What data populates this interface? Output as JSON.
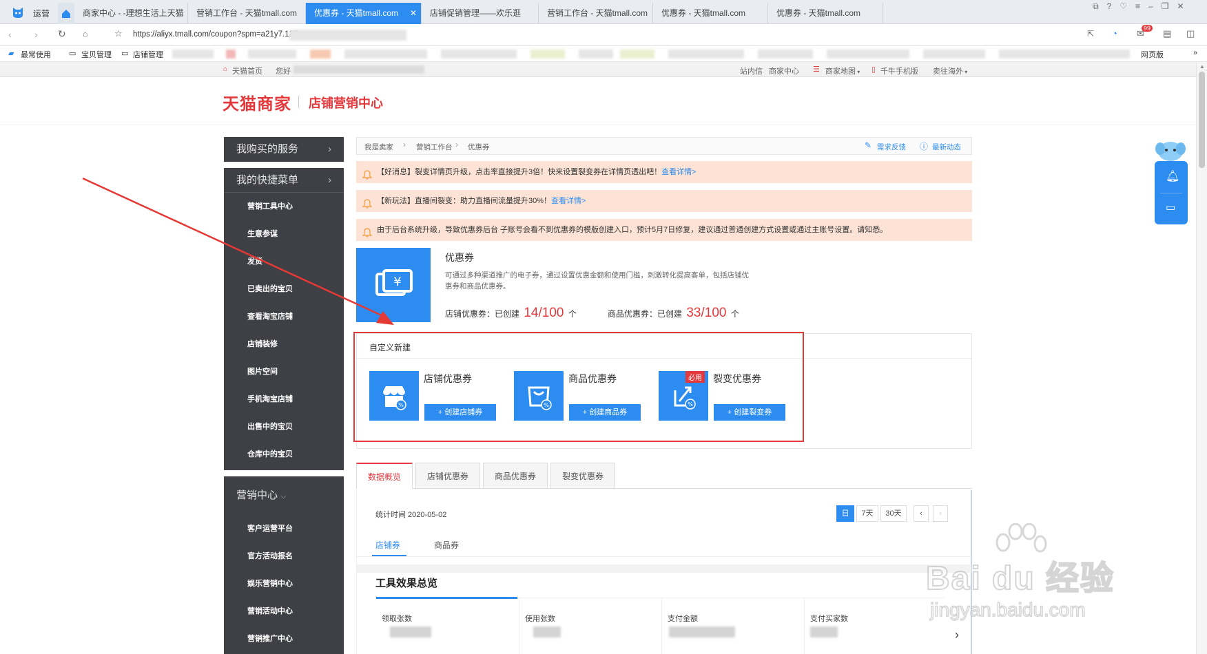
{
  "browser": {
    "app_label": "运营",
    "tabs": [
      {
        "label": "商家中心 - -理想生活上天猫"
      },
      {
        "label": "营销工作台 - 天猫tmall.com"
      },
      {
        "label": "优惠券 - 天猫tmall.com"
      },
      {
        "label": "店铺促销管理——欢乐逛"
      },
      {
        "label": "营销工作台 - 天猫tmall.com"
      },
      {
        "label": "优惠券 - 天猫tmall.com"
      },
      {
        "label": "优惠券 - 天猫tmall.com"
      }
    ],
    "url": "https://aliyx.tmall.com/coupon?spm=a21y7.127",
    "mail_badge": "99",
    "bookmarks": [
      "最常使用",
      "宝贝管理",
      "店铺管理"
    ],
    "bookmarks_right": [
      "网页版"
    ]
  },
  "sitebar": {
    "home": "天猫首页",
    "greeting": "您好",
    "links": [
      "站内信",
      "商家中心",
      "商家地图",
      "千牛手机版",
      "卖往海外"
    ]
  },
  "header": {
    "logo": "天猫商家",
    "subtitle": "店铺营销中心"
  },
  "sidebar": {
    "services": "我购买的服务",
    "quick_menu": "我的快捷菜单",
    "quick_items": [
      "营销工具中心",
      "生意参谋",
      "发货",
      "已卖出的宝贝",
      "查看淘宝店铺",
      "店铺装修",
      "图片空间",
      "手机淘宝店铺",
      "出售中的宝贝",
      "仓库中的宝贝"
    ],
    "marketing": "营销中心",
    "marketing_items": [
      "客户运营平台",
      "官方活动报名",
      "娱乐营销中心",
      "营销活动中心",
      "营销推广中心"
    ]
  },
  "breadcrumb": {
    "items": [
      "我是卖家",
      "营销工作台",
      "优惠券"
    ],
    "feedback": "需求反馈",
    "news": "最新动态"
  },
  "notices": [
    {
      "text": "【好消息】裂变详情页升级，点击率直接提升3倍！快来设置裂变券在详情页透出吧！",
      "link": "查看详情>"
    },
    {
      "text": "【新玩法】直播间裂变：助力直播间流量提升30%！",
      "link": "查看详情>"
    },
    {
      "text": "由于后台系统升级，导致优惠券后台 子账号会看不到优惠券的模版创建入口，预计5月7日修复，建议通过普通创建方式设置或通过主账号设置。请知悉。",
      "link": ""
    }
  ],
  "coupon_intro": {
    "title": "优惠券",
    "desc": "可通过多种渠道推广的电子券，通过设置优惠金额和使用门槛，刺激转化提高客单，包括店铺优惠券和商品优惠券。",
    "shop_label": "店铺优惠券：已创建",
    "shop_count": "14/100",
    "shop_unit": "个",
    "item_label": "商品优惠券：已创建",
    "item_count": "33/100",
    "item_unit": "个"
  },
  "custom_create": {
    "title": "自定义新建",
    "cards": [
      {
        "name": "店铺优惠券",
        "button": "+ 创建店铺券",
        "badge": ""
      },
      {
        "name": "商品优惠券",
        "button": "+ 创建商品券",
        "badge": ""
      },
      {
        "name": "裂变优惠券",
        "button": "+ 创建裂变券",
        "badge": "必用"
      }
    ]
  },
  "data_tabs": [
    "数据概览",
    "店铺优惠券",
    "商品优惠券",
    "裂变优惠券"
  ],
  "stats": {
    "time_label": "统计时间 2020-05-02",
    "ranges": [
      "日",
      "7天",
      "30天"
    ],
    "subtabs": [
      "店铺券",
      "商品券"
    ],
    "section_title": "工具效果总览",
    "metrics": [
      "领取张数",
      "使用张数",
      "支付金额",
      "支付买家数"
    ]
  },
  "watermark": {
    "main": "Bai du 经验",
    "sub": "jingyan.baidu.com"
  },
  "colors": {
    "accent": "#2d8cf0",
    "brand_red": "#e4393c",
    "sidebar": "#3f4045",
    "notice_bg": "#fce3d5",
    "annotation": "#e53935"
  }
}
